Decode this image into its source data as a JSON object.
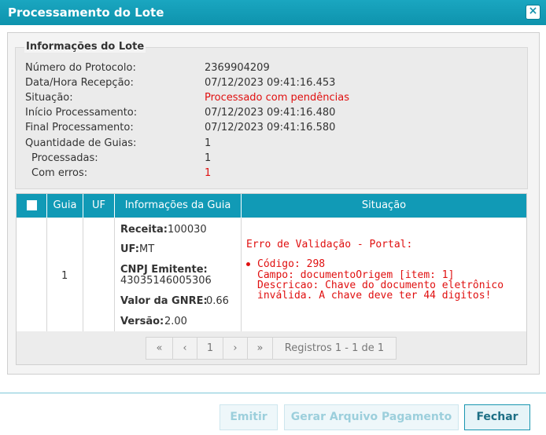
{
  "dialog": {
    "title": "Processamento do Lote",
    "close_label": "×"
  },
  "info": {
    "legend": "Informações do Lote",
    "rows": [
      {
        "label": "Número do Protocolo:",
        "value": "2369904209"
      },
      {
        "label": "Data/Hora Recepção:",
        "value": "07/12/2023 09:41:16.453"
      },
      {
        "label": "Situação:",
        "value": "Processado com pendências"
      },
      {
        "label": "Início Processamento:",
        "value": "07/12/2023 09:41:16.480"
      },
      {
        "label": "Final Processamento:",
        "value": "07/12/2023 09:41:16.580"
      },
      {
        "label": "Quantidade de Guias:",
        "value": "1"
      },
      {
        "label": "Processadas:",
        "value": "1"
      },
      {
        "label": "Com erros:",
        "value": "1"
      }
    ]
  },
  "grid": {
    "headers": {
      "guia": "Guia",
      "uf": "UF",
      "info": "Informações da Guia",
      "situacao": "Situação"
    },
    "row": {
      "guia": "1",
      "receita_label": "Receita:",
      "receita_value": "100030",
      "uf_label": "UF:",
      "uf_value": "MT",
      "cnpj_label": "CNPJ Emitente:",
      "cnpj_value": "43035146005306",
      "valor_label": "Valor da GNRE:",
      "valor_value": "0.66",
      "versao_label": "Versão:",
      "versao_value": "2.00",
      "situacao_title": "Erro de Validação - Portal:",
      "situacao_lines": [
        "Código: 298",
        "Campo: documentoOrigem [item: 1]",
        "Descricao: Chave do documento eletrônico",
        "inválida. A chave deve ter 44 digitos!"
      ]
    }
  },
  "pager": {
    "first": "«",
    "prev": "‹",
    "page": "1",
    "next": "›",
    "last": "»",
    "summary": "Registros 1 - 1 de 1"
  },
  "footer": {
    "emitir": "Emitir",
    "gerar": "Gerar Arquivo Pagamento",
    "fechar": "Fechar"
  },
  "colors": {
    "header": "#119ab6",
    "error": "#e01010"
  }
}
